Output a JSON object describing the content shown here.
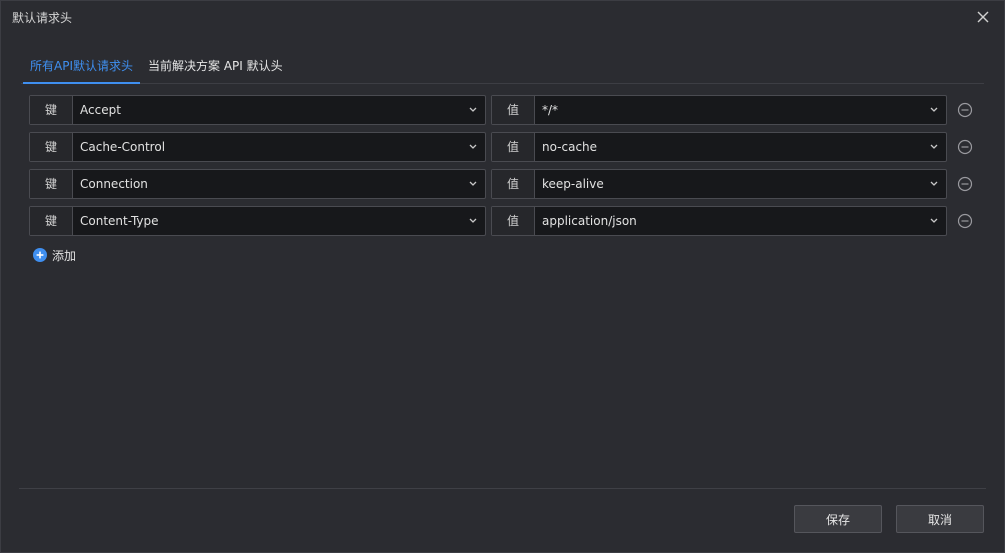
{
  "dialog": {
    "title": "默认请求头",
    "close_icon": "close-icon"
  },
  "tabs": [
    {
      "label": "所有API默认请求头",
      "active": true
    },
    {
      "label": "当前解决方案 API 默认头",
      "active": false
    }
  ],
  "labels": {
    "key": "键",
    "value": "值"
  },
  "headers": [
    {
      "key": "Accept",
      "value": "*/*"
    },
    {
      "key": "Cache-Control",
      "value": "no-cache"
    },
    {
      "key": "Connection",
      "value": "keep-alive"
    },
    {
      "key": "Content-Type",
      "value": "application/json"
    }
  ],
  "add": {
    "label": "添加",
    "icon": "plus-circle-icon"
  },
  "footer": {
    "save_label": "保存",
    "cancel_label": "取消"
  },
  "colors": {
    "accent": "#3f8ff0",
    "background": "#2b2c31",
    "input_background": "#17181b"
  }
}
